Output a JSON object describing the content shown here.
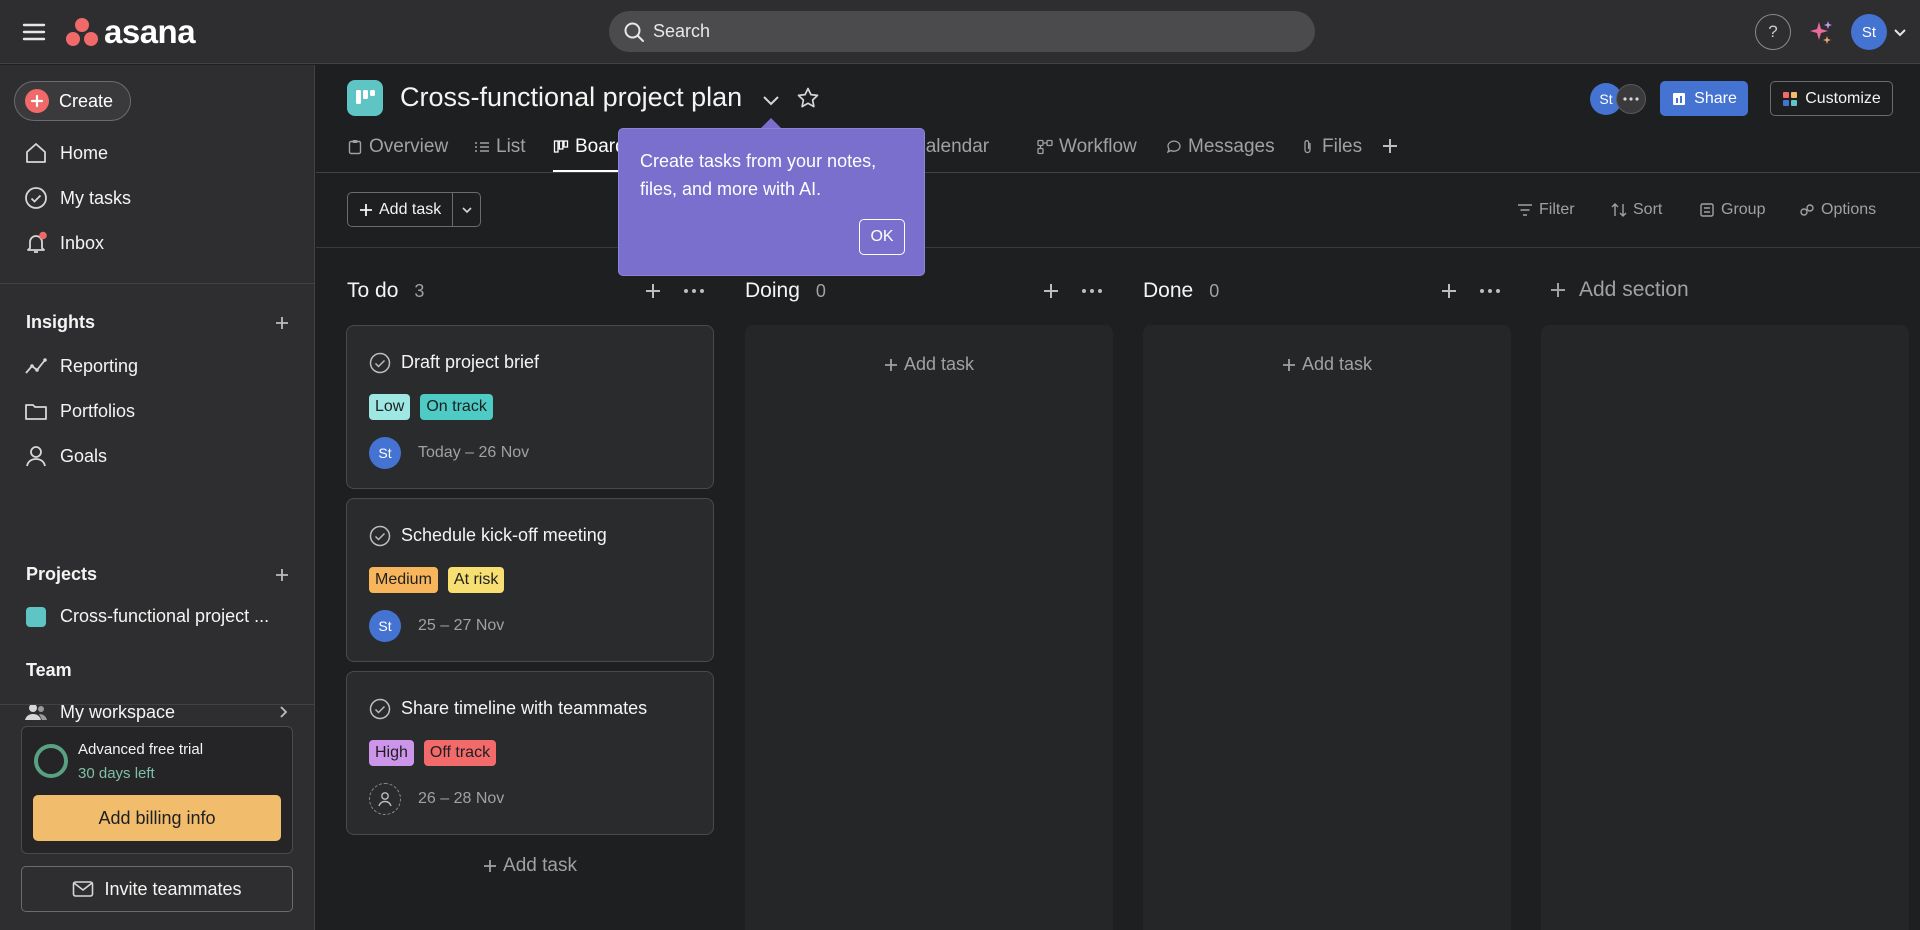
{
  "topbar": {
    "app_name": "asana",
    "search_placeholder": "Search",
    "help_label": "?",
    "user_initials": "St",
    "logo_colors": [
      "#f06a6a"
    ]
  },
  "sidebar": {
    "create_label": "Create",
    "nav": [
      {
        "label": "Home",
        "icon": "home-icon"
      },
      {
        "label": "My tasks",
        "icon": "check-circle-icon"
      },
      {
        "label": "Inbox",
        "icon": "bell-icon",
        "has_notification": true
      }
    ],
    "insights": {
      "header": "Insights",
      "items": [
        {
          "label": "Reporting",
          "icon": "trend-line-icon"
        },
        {
          "label": "Portfolios",
          "icon": "folder-icon"
        },
        {
          "label": "Goals",
          "icon": "person-icon"
        }
      ]
    },
    "projects": {
      "header": "Projects",
      "items": [
        {
          "label": "Cross-functional project ...",
          "color": "#5ec4c4"
        }
      ]
    },
    "team": {
      "header": "Team",
      "items": [
        {
          "label": "My workspace",
          "icon": "people-icon"
        }
      ]
    },
    "trial": {
      "title": "Advanced free trial",
      "days_left": "30 days left",
      "billing_label": "Add billing info"
    },
    "invite_label": "Invite teammates"
  },
  "project": {
    "title": "Cross-functional project plan",
    "member_initials": "St",
    "share_label": "Share",
    "customize_label": "Customize",
    "tabs": [
      {
        "label": "Overview",
        "icon": "clipboard-icon"
      },
      {
        "label": "List",
        "icon": "list-icon"
      },
      {
        "label": "Board",
        "icon": "board-icon",
        "active": true
      },
      {
        "label": "Calendar",
        "icon": "calendar-icon"
      },
      {
        "label": "Workflow",
        "icon": "workflow-icon"
      },
      {
        "label": "Messages",
        "icon": "chat-icon"
      },
      {
        "label": "Files",
        "icon": "paperclip-icon"
      }
    ]
  },
  "toolbar": {
    "add_task_label": "Add task",
    "filter_label": "Filter",
    "sort_label": "Sort",
    "group_label": "Group",
    "options_label": "Options"
  },
  "board": {
    "columns": [
      {
        "name": "To do",
        "count": "3"
      },
      {
        "name": "Doing",
        "count": "0",
        "add_label": "Add task"
      },
      {
        "name": "Done",
        "count": "0",
        "add_label": "Add task"
      }
    ],
    "cards": [
      {
        "title": "Draft project brief",
        "priority": "Low",
        "status": "On track",
        "assignee": "St",
        "date": "Today – 26 Nov"
      },
      {
        "title": "Schedule kick-off meeting",
        "priority": "Medium",
        "status": "At risk",
        "assignee": "St",
        "date": "25 – 27 Nov"
      },
      {
        "title": "Share timeline with teammates",
        "priority": "High",
        "status": "Off track",
        "assignee": "",
        "date": "26 – 28 Nov"
      }
    ],
    "todo_add_label": "Add task",
    "add_section_label": "Add section",
    "tag_colors": {
      "Low": "#9ee7e3",
      "On track": "#4ecbc4",
      "Medium": "#f8b65c",
      "At risk": "#f8df72",
      "High": "#cd95ea",
      "Off track": "#f26a6a"
    }
  },
  "tooltip": {
    "text": "Create tasks from your notes, files, and more with AI.",
    "ok_label": "OK"
  }
}
